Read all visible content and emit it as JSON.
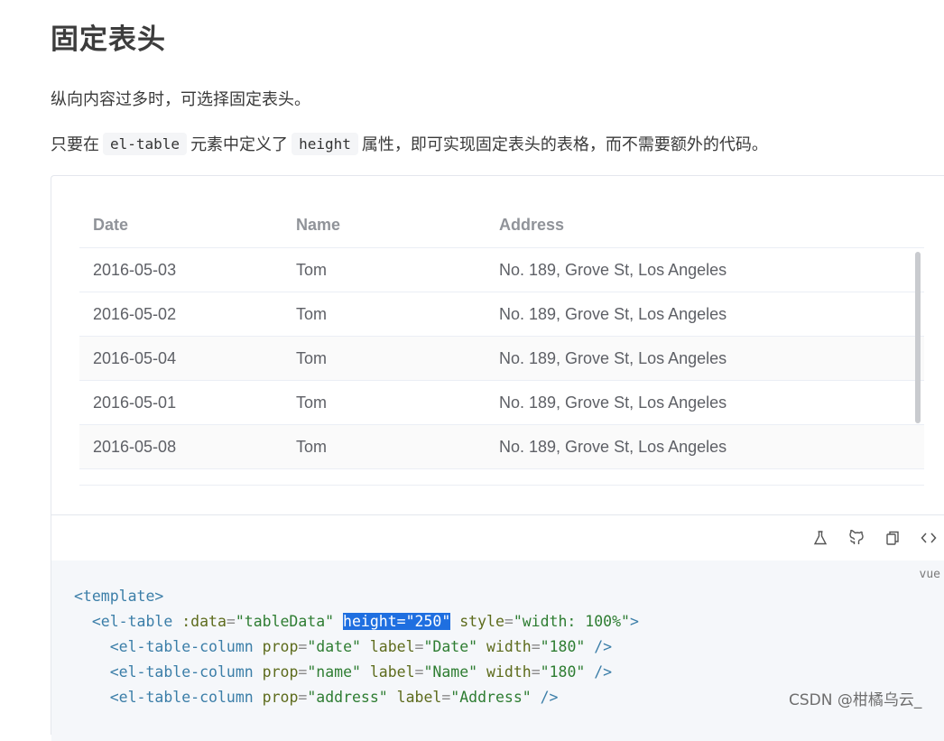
{
  "page": {
    "title": "固定表头",
    "intro": "纵向内容过多时，可选择固定表头。",
    "desc": {
      "before": "只要在",
      "code1": "el-table",
      "middle": "元素中定义了",
      "code2": "height",
      "after": "属性，即可实现固定表头的表格，而不需要额外的代码。"
    }
  },
  "table": {
    "headers": [
      "Date",
      "Name",
      "Address"
    ],
    "rows": [
      {
        "date": "2016-05-03",
        "name": "Tom",
        "address": "No. 189, Grove St, Los Angeles"
      },
      {
        "date": "2016-05-02",
        "name": "Tom",
        "address": "No. 189, Grove St, Los Angeles"
      },
      {
        "date": "2016-05-04",
        "name": "Tom",
        "address": "No. 189, Grove St, Los Angeles"
      },
      {
        "date": "2016-05-01",
        "name": "Tom",
        "address": "No. 189, Grove St, Los Angeles"
      },
      {
        "date": "2016-05-08",
        "name": "Tom",
        "address": "No. 189, Grove St, Los Angeles"
      }
    ]
  },
  "toolbar": {
    "icons": [
      "flask-icon",
      "github-icon",
      "copy-icon",
      "code-icon"
    ]
  },
  "code": {
    "lang": "vue",
    "l1_tag": "<template>",
    "l2_tag": "<el-table",
    "l2_attr1": ":data",
    "l2_val1": "\"tableData\"",
    "l2_hl": "height=\"250\"",
    "l2_attr3": "style",
    "l2_val3": "\"width: 100%\"",
    "l2_close": ">",
    "l3_tag": "<el-table-column",
    "l3_attr1": "prop",
    "l3_val1": "\"date\"",
    "l3_attr2": "label",
    "l3_val2": "\"Date\"",
    "l3_attr3": "width",
    "l3_val3": "\"180\"",
    "l3_close": "/>",
    "l4_tag": "<el-table-column",
    "l4_attr1": "prop",
    "l4_val1": "\"name\"",
    "l4_attr2": "label",
    "l4_val2": "\"Name\"",
    "l4_attr3": "width",
    "l4_val3": "\"180\"",
    "l4_close": "/>",
    "l5_tag": "<el-table-column",
    "l5_attr1": "prop",
    "l5_val1": "\"address\"",
    "l5_attr2": "label",
    "l5_val2": "\"Address\"",
    "l5_close": "/>"
  },
  "watermark": "CSDN @柑橘乌云_"
}
